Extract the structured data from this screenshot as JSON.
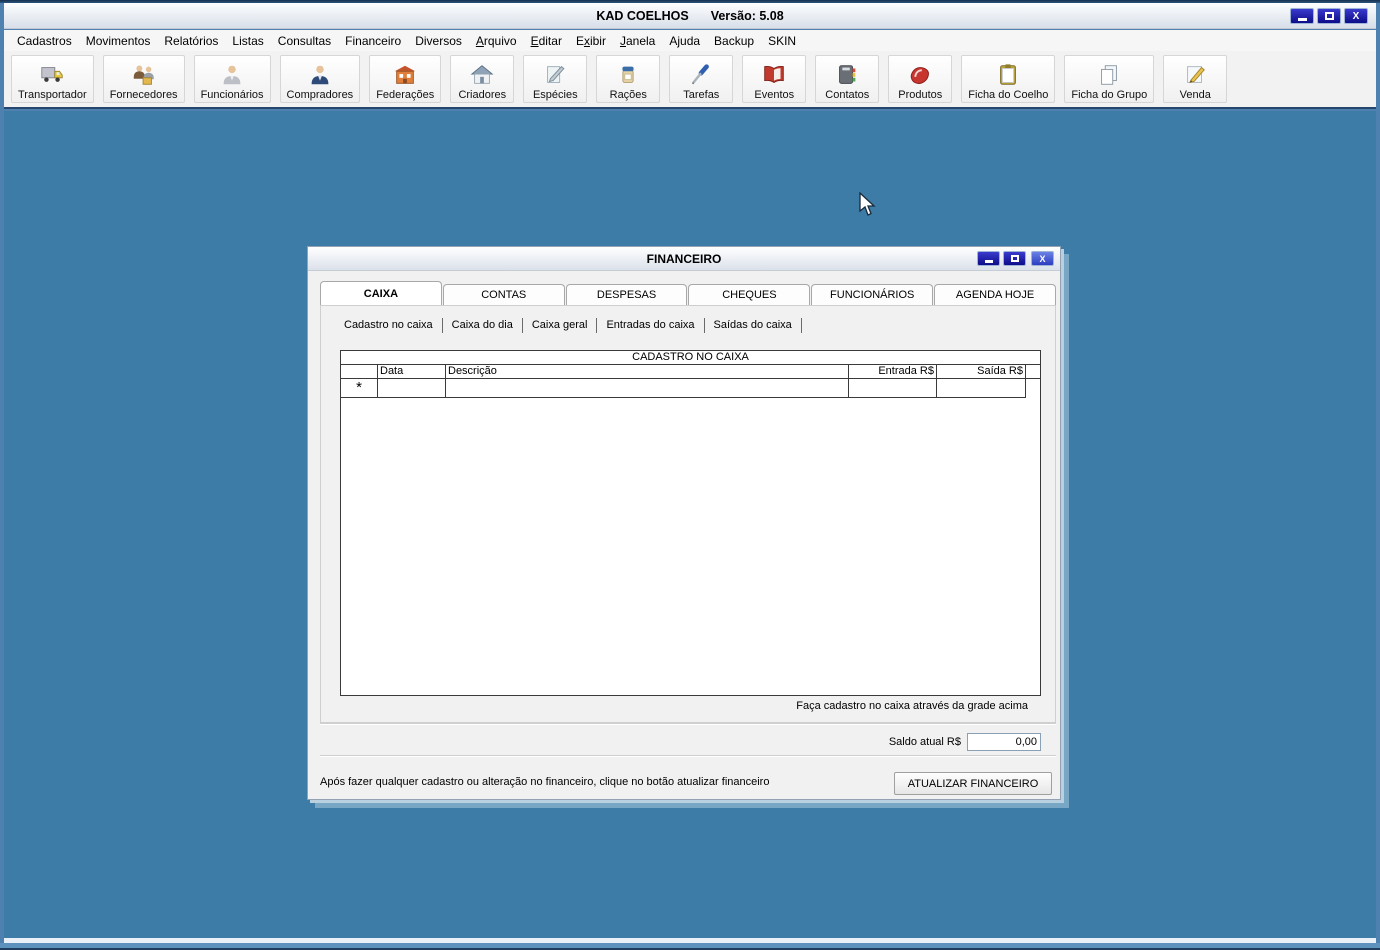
{
  "window": {
    "title": "KAD COELHOS",
    "version": "Versão: 5.08",
    "close_glyph": "X"
  },
  "menu": {
    "items": [
      {
        "pre": "Cadastros",
        "u": "",
        "post": ""
      },
      {
        "pre": "Movimentos",
        "u": "",
        "post": ""
      },
      {
        "pre": "Relatórios",
        "u": "",
        "post": ""
      },
      {
        "pre": "Listas",
        "u": "",
        "post": ""
      },
      {
        "pre": "Consultas",
        "u": "",
        "post": ""
      },
      {
        "pre": "Financeiro",
        "u": "",
        "post": ""
      },
      {
        "pre": "Diversos",
        "u": "",
        "post": ""
      },
      {
        "pre": "",
        "u": "A",
        "post": "rquivo"
      },
      {
        "pre": "",
        "u": "E",
        "post": "ditar"
      },
      {
        "pre": "E",
        "u": "x",
        "post": "ibir"
      },
      {
        "pre": "",
        "u": "J",
        "post": "anela"
      },
      {
        "pre": "Ajuda",
        "u": "",
        "post": ""
      },
      {
        "pre": "Backup",
        "u": "",
        "post": ""
      },
      {
        "pre": "SKIN",
        "u": "",
        "post": ""
      }
    ]
  },
  "toolbar": {
    "items": [
      {
        "label": "Transportador"
      },
      {
        "label": "Fornecedores"
      },
      {
        "label": "Funcionários"
      },
      {
        "label": "Compradores"
      },
      {
        "label": "Federações"
      },
      {
        "label": "Criadores"
      },
      {
        "label": "Espécies"
      },
      {
        "label": "Rações"
      },
      {
        "label": "Tarefas"
      },
      {
        "label": "Eventos"
      },
      {
        "label": "Contatos"
      },
      {
        "label": "Produtos"
      },
      {
        "label": "Ficha do Coelho"
      },
      {
        "label": "Ficha do Grupo"
      },
      {
        "label": "Venda"
      }
    ]
  },
  "dialog": {
    "title": "FINANCEIRO",
    "close_glyph": "X",
    "tabs": [
      "CAIXA",
      "CONTAS",
      "DESPESAS",
      "CHEQUES",
      "FUNCIONÁRIOS",
      "AGENDA HOJE"
    ],
    "active_tab": "CAIXA",
    "subtabs": [
      "Cadastro no caixa",
      "Caixa do dia",
      "Caixa geral",
      "Entradas do caixa",
      "Saídas do caixa"
    ],
    "active_subtab": "Cadastro no caixa",
    "grid": {
      "title": "CADASTRO NO CAIXA",
      "columns": {
        "data": "Data",
        "descricao": "Descrição",
        "entrada": "Entrada R$",
        "saida": "Saída R$"
      },
      "new_row_marker": "*",
      "rows": [
        {
          "marker": "*",
          "data": "",
          "descricao": "",
          "entrada": "",
          "saida": ""
        }
      ]
    },
    "hint": "Faça cadastro no caixa através da grade acima",
    "saldo_label": "Saldo atual R$",
    "saldo_value": "0,00",
    "footer_note": "Após fazer qualquer cadastro ou alteração no financeiro, clique no botão atualizar financeiro",
    "update_button_label": "ATUALIZAR FINANCEIRO"
  },
  "colors": {
    "desktop": "#3D7CA6",
    "frame": "#4E81AF",
    "control_button_navy": "#1414A0",
    "grid_border": "#3A3A3A",
    "toolbar_separator": "#26456F"
  }
}
